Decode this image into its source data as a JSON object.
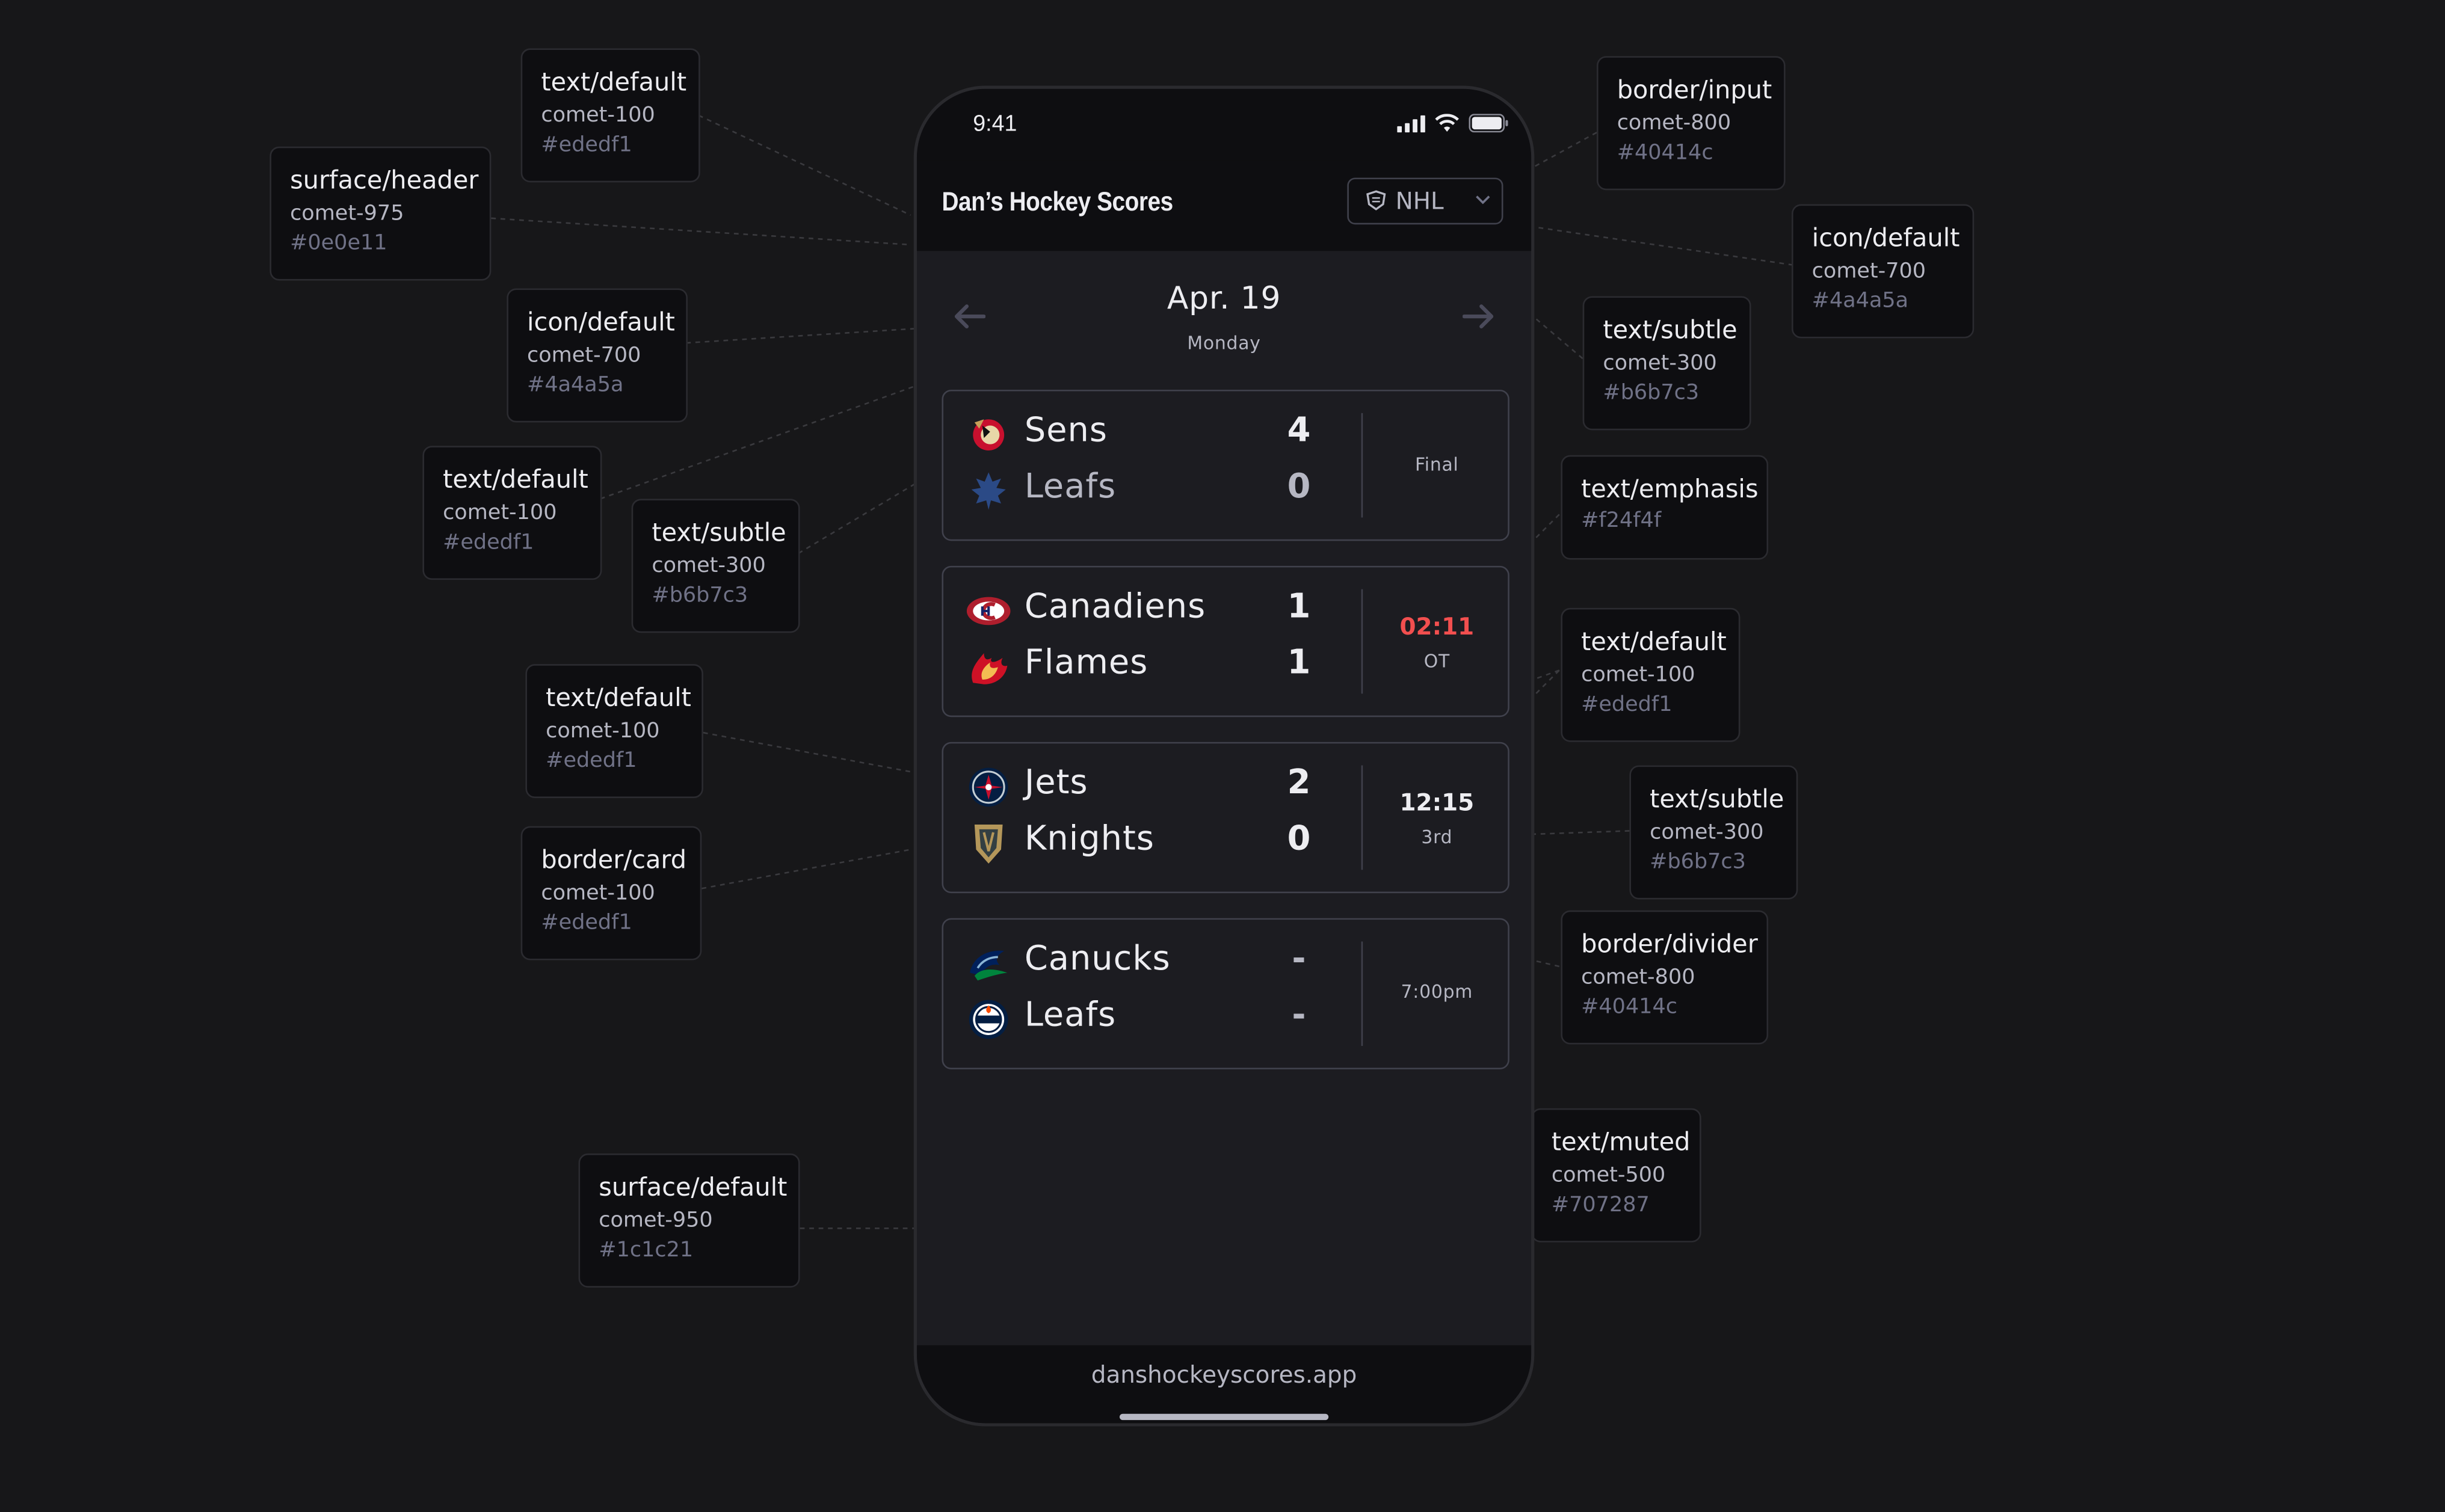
{
  "callouts": [
    {
      "token": "text/default",
      "name": "comet-100",
      "hex": "#ededf1"
    },
    {
      "token": "surface/header",
      "name": "comet-975",
      "hex": "#0e0e11"
    },
    {
      "token": "icon/default",
      "name": "comet-700",
      "hex": "#4a4a5a"
    },
    {
      "token": "text/default",
      "name": "comet-100",
      "hex": "#ededf1"
    },
    {
      "token": "text/subtle",
      "name": "comet-300",
      "hex": "#b6b7c3"
    },
    {
      "token": "text/default",
      "name": "comet-100",
      "hex": "#ededf1"
    },
    {
      "token": "border/card",
      "name": "comet-100",
      "hex": "#ededf1"
    },
    {
      "token": "surface/default",
      "name": "comet-950",
      "hex": "#1c1c21"
    },
    {
      "token": "border/input",
      "name": "comet-800",
      "hex": "#40414c"
    },
    {
      "token": "icon/default",
      "name": "comet-700",
      "hex": "#4a4a5a"
    },
    {
      "token": "text/subtle",
      "name": "comet-300",
      "hex": "#b6b7c3"
    },
    {
      "token": "text/emphasis",
      "name": "",
      "hex": "#f24f4f"
    },
    {
      "token": "text/default",
      "name": "comet-100",
      "hex": "#ededf1"
    },
    {
      "token": "text/subtle",
      "name": "comet-300",
      "hex": "#b6b7c3"
    },
    {
      "token": "border/divider",
      "name": "comet-800",
      "hex": "#40414c"
    },
    {
      "token": "text/muted",
      "name": "comet-500",
      "hex": "#707287"
    }
  ],
  "phone": {
    "status_time": "9:41",
    "app_title": "Dan’s Hockey Scores",
    "league": "NHL",
    "date": "Apr. 19",
    "weekday": "Monday",
    "footer_url": "danshockeyscores.app"
  },
  "games": [
    {
      "home": "Sens",
      "home_logo": "senators-logo",
      "home_score": "4",
      "away": "Leafs",
      "away_logo": "maple-leafs-logo",
      "away_score": "0",
      "status": "",
      "status_detail": "Final",
      "status_color": "#ededf1"
    },
    {
      "home": "Canadiens",
      "home_logo": "canadiens-logo",
      "home_score": "1",
      "away": "Flames",
      "away_logo": "flames-logo",
      "away_score": "1",
      "status": "02:11",
      "status_detail": "OT",
      "status_color": "#f24f4f"
    },
    {
      "home": "Jets",
      "home_logo": "jets-logo",
      "home_score": "2",
      "away": "Knights",
      "away_logo": "golden-knights-logo",
      "away_score": "0",
      "status": "12:15",
      "status_detail": "3rd",
      "status_color": "#ededf1"
    },
    {
      "home": "Canucks",
      "home_logo": "canucks-logo",
      "home_score": "-",
      "away": "Leafs",
      "away_logo": "oilers-logo",
      "away_score": "-",
      "status": "",
      "status_detail": "7:00pm",
      "status_color": "#ededf1"
    }
  ]
}
